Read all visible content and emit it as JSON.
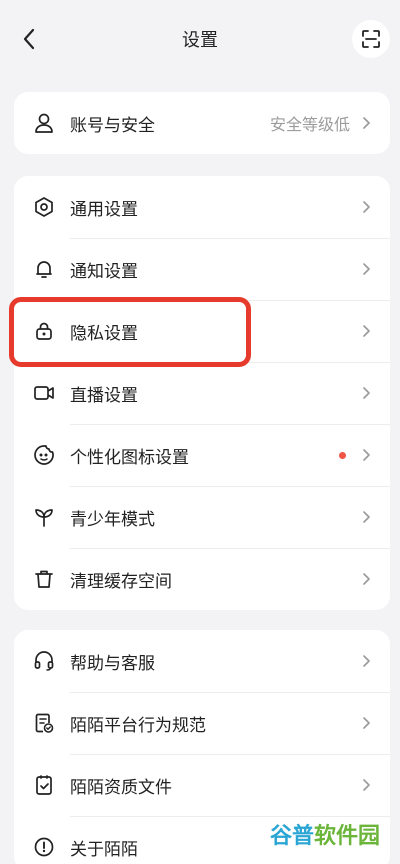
{
  "header": {
    "title": "设置",
    "back_icon": "chevron-left-icon",
    "scan_icon": "scan-icon"
  },
  "groups": [
    {
      "items": [
        {
          "label": "账号与安全",
          "value": "安全等级低",
          "icon": "user-icon"
        }
      ]
    },
    {
      "items": [
        {
          "label": "通用设置",
          "icon": "hexagon-settings-icon"
        },
        {
          "label": "通知设置",
          "icon": "bell-icon"
        },
        {
          "label": "隐私设置",
          "icon": "lock-icon",
          "highlighted": true
        },
        {
          "label": "直播设置",
          "icon": "video-camera-icon"
        },
        {
          "label": "个性化图标设置",
          "icon": "emoji-icon",
          "badge": "red-dot"
        },
        {
          "label": "青少年模式",
          "icon": "sprout-icon"
        },
        {
          "label": "清理缓存空间",
          "icon": "trash-icon"
        }
      ]
    },
    {
      "items": [
        {
          "label": "帮助与客服",
          "icon": "headset-icon"
        },
        {
          "label": "陌陌平台行为规范",
          "icon": "document-check-icon"
        },
        {
          "label": "陌陌资质文件",
          "icon": "clipboard-check-icon"
        },
        {
          "label": "关于陌陌",
          "icon": "info-icon"
        }
      ]
    }
  ],
  "watermark": {
    "part1": "谷普",
    "part2": "软件园"
  },
  "colors": {
    "background": "#f3f3f5",
    "card": "#ffffff",
    "highlight_border": "#e53a2c",
    "dot": "#f05545",
    "secondary_text": "#9c9c9c"
  }
}
